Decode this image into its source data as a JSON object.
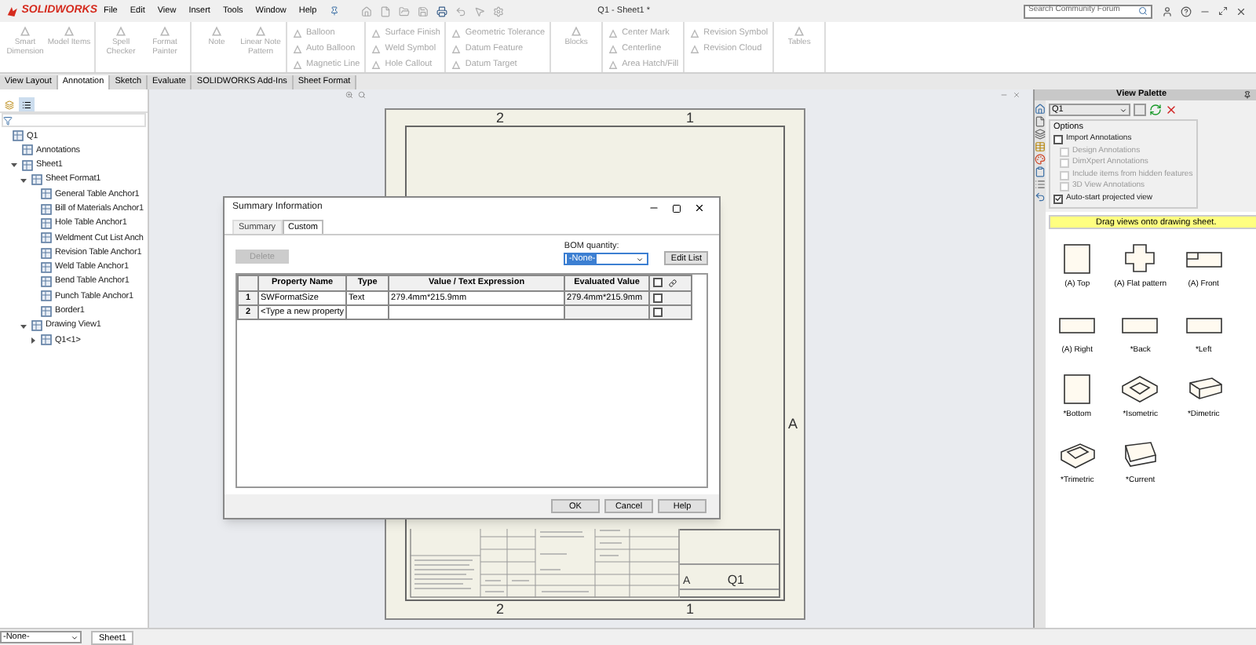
{
  "app": {
    "logo": "SOLIDWORKS",
    "menu": [
      "File",
      "Edit",
      "View",
      "Insert",
      "Tools",
      "Window",
      "Help"
    ],
    "title": "Q1 - Sheet1 *",
    "search": {
      "placeholder": "Search Community Forum"
    }
  },
  "ribbon": [
    {
      "kind": "large",
      "commands": [
        {
          "label": "Smart Dimension",
          "disabled": true
        },
        {
          "label": "Model Items",
          "disabled": true
        }
      ]
    },
    {
      "kind": "large",
      "commands": [
        {
          "label": "Spell Checker",
          "disabled": true
        },
        {
          "label": "Format Painter",
          "disabled": true
        }
      ]
    },
    {
      "kind": "large",
      "commands": [
        {
          "label": "Note",
          "disabled": true
        },
        {
          "label": "Linear Note Pattern",
          "disabled": true
        }
      ]
    },
    {
      "kind": "small",
      "commands": [
        {
          "label": "Balloon",
          "disabled": true
        },
        {
          "label": "Auto Balloon",
          "disabled": true
        },
        {
          "label": "Magnetic Line",
          "disabled": true
        }
      ]
    },
    {
      "kind": "small",
      "commands": [
        {
          "label": "Surface Finish",
          "disabled": true
        },
        {
          "label": "Weld Symbol",
          "disabled": true
        },
        {
          "label": "Hole Callout",
          "disabled": true
        }
      ]
    },
    {
      "kind": "small",
      "commands": [
        {
          "label": "Geometric Tolerance",
          "disabled": true
        },
        {
          "label": "Datum Feature",
          "disabled": true
        },
        {
          "label": "Datum Target",
          "disabled": true
        }
      ]
    },
    {
      "kind": "large",
      "commands": [
        {
          "label": "Blocks",
          "disabled": true
        }
      ]
    },
    {
      "kind": "small",
      "commands": [
        {
          "label": "Center Mark",
          "disabled": true
        },
        {
          "label": "Centerline",
          "disabled": true
        },
        {
          "label": "Area Hatch/Fill",
          "disabled": true
        }
      ]
    },
    {
      "kind": "small",
      "commands": [
        {
          "label": "Revision Symbol",
          "disabled": true
        },
        {
          "label": "Revision Cloud",
          "disabled": true
        }
      ]
    },
    {
      "kind": "large",
      "commands": [
        {
          "label": "Tables",
          "disabled": true
        }
      ]
    }
  ],
  "command_tabs": [
    {
      "label": "View Layout",
      "selected": false
    },
    {
      "label": "Annotation",
      "selected": true
    },
    {
      "label": "Sketch",
      "selected": false
    },
    {
      "label": "Evaluate",
      "selected": false
    },
    {
      "label": "SOLIDWORKS Add-Ins",
      "selected": false
    },
    {
      "label": "Sheet Format",
      "selected": false
    }
  ],
  "feature_tree": [
    {
      "label": "Q1",
      "children": [
        {
          "label": "Annotations"
        },
        {
          "label": "Sheet1",
          "expanded": true,
          "children": [
            {
              "label": "Sheet Format1",
              "expanded": true,
              "children": [
                {
                  "label": "General Table Anchor1"
                },
                {
                  "label": "Bill of Materials Anchor1"
                },
                {
                  "label": "Hole Table Anchor1"
                },
                {
                  "label": "Weldment Cut List Anch"
                },
                {
                  "label": "Revision Table Anchor1"
                },
                {
                  "label": "Weld Table Anchor1"
                },
                {
                  "label": "Bend Table Anchor1"
                },
                {
                  "label": "Punch Table Anchor1"
                },
                {
                  "label": "Border1"
                }
              ]
            },
            {
              "label": "Drawing View1",
              "expanded": true,
              "children": [
                {
                  "label": "Q1<1>",
                  "expanded": false
                }
              ]
            }
          ]
        }
      ]
    }
  ],
  "sheet": {
    "top_zones": [
      "2",
      "1"
    ],
    "bottom_zones": [
      "2",
      "1"
    ],
    "right_zones": [
      "A"
    ],
    "drawing_number": "Q1",
    "size": "A"
  },
  "dialog": {
    "title": "Summary Information",
    "tabs": [
      {
        "label": "Summary",
        "selected": false
      },
      {
        "label": "Custom",
        "selected": true
      }
    ],
    "delete_button": {
      "label": "Delete",
      "disabled": true
    },
    "bom_quantity": {
      "label": "BOM quantity:",
      "value": "-None-"
    },
    "edit_list_button": "Edit List",
    "table": {
      "columns": [
        "Property Name",
        "Type",
        "Value / Text Expression",
        "Evaluated Value"
      ],
      "header_checked": false,
      "rows": [
        {
          "number": "1",
          "property_name": "SWFormatSize",
          "type": "Text",
          "value": "279.4mm*215.9mm",
          "evaluated": "279.4mm*215.9mm",
          "checked": false
        },
        {
          "number": "2",
          "property_name": "<Type a new property",
          "type": "",
          "value": "",
          "evaluated": "",
          "checked": false
        }
      ]
    },
    "buttons": [
      "OK",
      "Cancel",
      "Help"
    ]
  },
  "view_palette": {
    "title": "View Palette",
    "model": "Q1",
    "options_title": "Options",
    "options": [
      {
        "label": "Import Annotations",
        "checked": false,
        "disabled": false,
        "children": [
          {
            "label": "Design Annotations",
            "checked": false,
            "disabled": true
          },
          {
            "label": "DimXpert Annotations",
            "checked": false,
            "disabled": true
          },
          {
            "label": "Include items from hidden features",
            "checked": false,
            "disabled": true
          },
          {
            "label": "3D View Annotations",
            "checked": false,
            "disabled": true
          }
        ]
      },
      {
        "label": "Auto-start projected view",
        "checked": true,
        "disabled": false
      }
    ],
    "message": "Drag views onto drawing sheet.",
    "views": [
      {
        "label": "(A) Top",
        "kind": "square"
      },
      {
        "label": "(A) Flat pattern",
        "kind": "flat"
      },
      {
        "label": "(A) Front",
        "kind": "notched"
      },
      {
        "label": "(A) Right",
        "kind": "wide"
      },
      {
        "label": "*Back",
        "kind": "wide"
      },
      {
        "label": "*Left",
        "kind": "wide"
      },
      {
        "label": "*Bottom",
        "kind": "square"
      },
      {
        "label": "*Isometric",
        "kind": "iso"
      },
      {
        "label": "*Dimetric",
        "kind": "dimetric"
      },
      {
        "label": "*Trimetric",
        "kind": "trimetric"
      },
      {
        "label": "*Current",
        "kind": "current"
      }
    ]
  },
  "status": {
    "configuration": "-None-",
    "sheet_tab": "Sheet1"
  }
}
